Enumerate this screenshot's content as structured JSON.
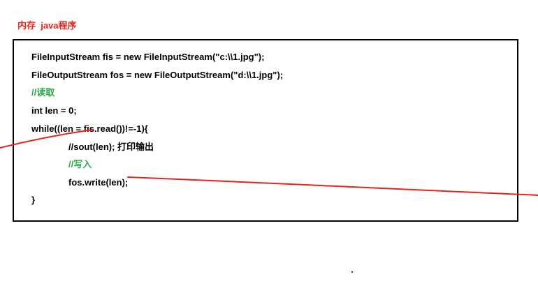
{
  "title": "内存  java程序",
  "code": {
    "line1": "FileInputStream fis = new FileInputStream(\"c:\\\\1.jpg\");",
    "line2": "FileOutputStream fos = new FileOutputStream(\"d:\\\\1.jpg\");",
    "line3": "//读取",
    "line4": "int len = 0;",
    "line5": "while((len = fis.read())!=-1){",
    "line6": "//sout(len); 打印输出",
    "line7": "//写入",
    "line8": "fos.write(len);",
    "line9": "}"
  },
  "colors": {
    "title": "#e8231e",
    "comment": "#2ba84a",
    "annotation_line": "#e8231e",
    "border": "#000000"
  }
}
